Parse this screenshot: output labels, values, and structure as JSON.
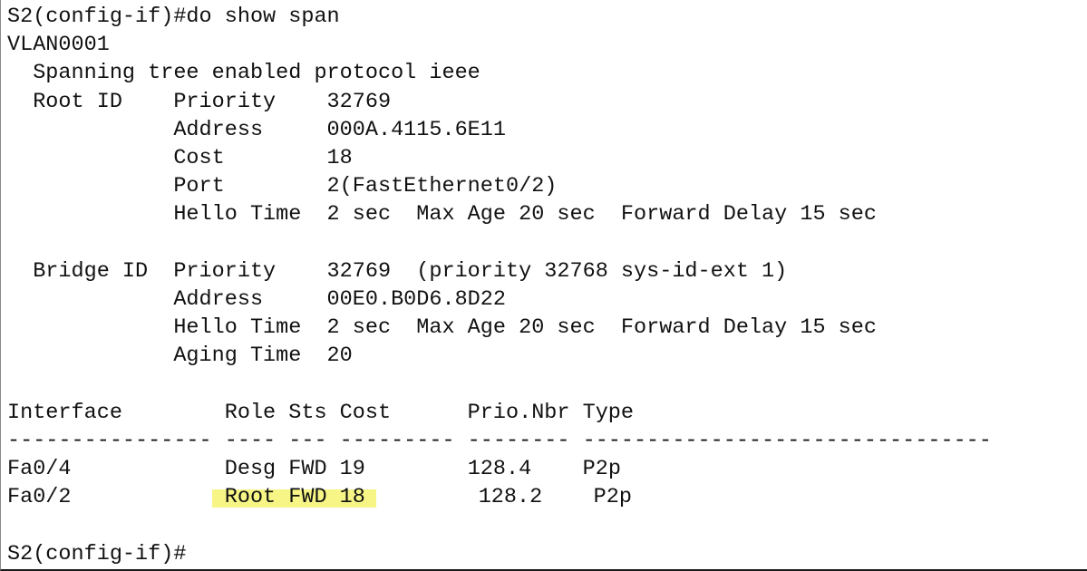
{
  "terminal": {
    "prompt_command": "S2(config-if)#do show span",
    "vlan": "VLAN0001",
    "protocol_line": "  Spanning tree enabled protocol ieee",
    "root": {
      "priority_line": "  Root ID    Priority    32769",
      "address_line": "             Address     000A.4115.6E11",
      "cost_line": "             Cost        18",
      "port_line": "             Port        2(FastEthernet0/2)",
      "hello_line": "             Hello Time  2 sec  Max Age 20 sec  Forward Delay 15 sec"
    },
    "bridge": {
      "priority_line": "  Bridge ID  Priority    32769  (priority 32768 sys-id-ext 1)",
      "address_line": "             Address     00E0.B0D6.8D22",
      "hello_line": "             Hello Time  2 sec  Max Age 20 sec  Forward Delay 15 sec",
      "aging_line": "             Aging Time  20"
    },
    "table": {
      "header": "Interface        Role Sts Cost      Prio.Nbr Type",
      "divider": "---------------- ---- --- --------- -------- --------------------------------",
      "rows": [
        {
          "interface_col": "Fa0/4            ",
          "role_sts_cost": "Desg FWD 19",
          "rest": "        128.4    P2p"
        },
        {
          "interface_col": "Fa0/2            ",
          "role_sts_cost": "Root FWD 18",
          "rest": "        128.2    P2p"
        }
      ]
    },
    "final_prompt": "S2(config-if)#",
    "highlight_color": "#f6f586"
  }
}
